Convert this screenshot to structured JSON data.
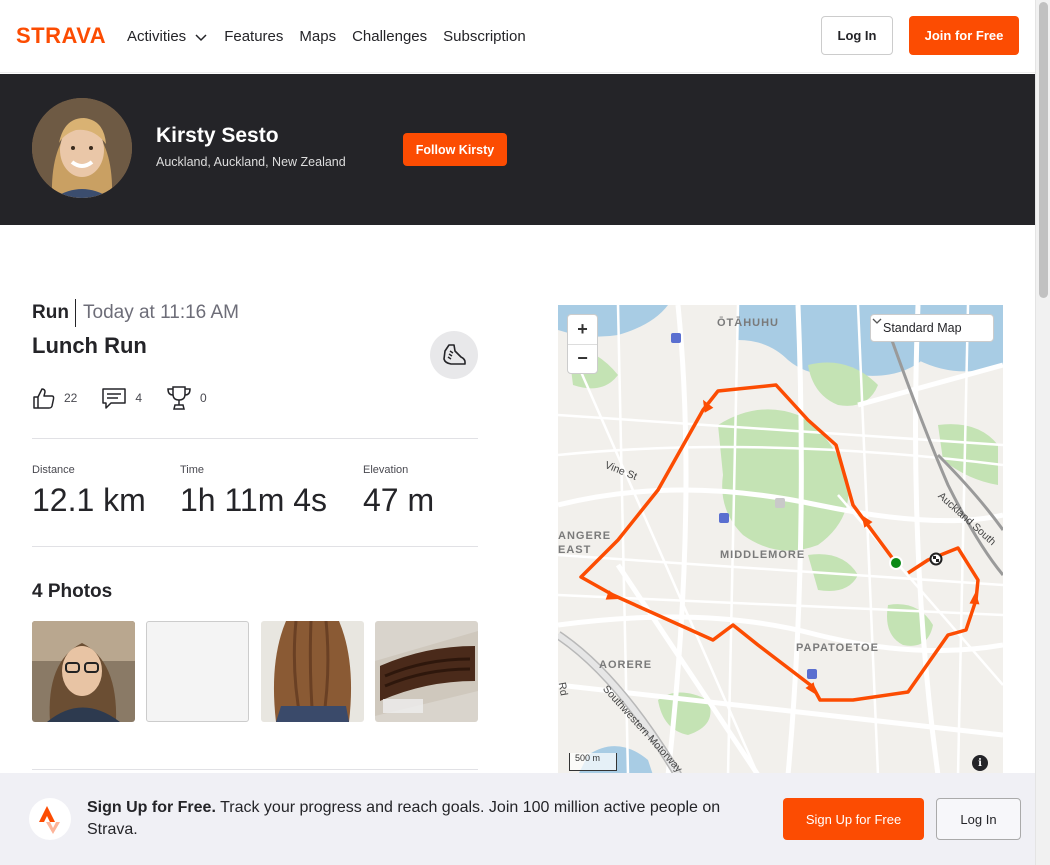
{
  "nav": {
    "logo": "STRAVA",
    "items": [
      {
        "label": "Activities",
        "has_dropdown": true
      },
      {
        "label": "Features"
      },
      {
        "label": "Maps"
      },
      {
        "label": "Challenges"
      },
      {
        "label": "Subscription"
      }
    ],
    "login_label": "Log In",
    "join_label": "Join for Free"
  },
  "athlete": {
    "name": "Kirsty Sesto",
    "location": "Auckland, Auckland, New Zealand",
    "follow_label": "Follow Kirsty"
  },
  "activity": {
    "type": "Run",
    "date": "Today at 11:16 AM",
    "title": "Lunch Run",
    "kudos": "22",
    "comments": "4",
    "achievements": "0"
  },
  "stats": [
    {
      "label": "Distance",
      "value": "12.1 km"
    },
    {
      "label": "Time",
      "value": "1h 11m 4s"
    },
    {
      "label": "Elevation",
      "value": "47 m"
    }
  ],
  "photos": {
    "title": "4 Photos"
  },
  "map": {
    "style_label": "Standard Map",
    "zoom_in": "+",
    "zoom_out": "−",
    "scale_label": "500 m",
    "info_label": "i",
    "labels": {
      "otahuhu": "ŌTĀHUHU",
      "middlemore": "MIDDLEMORE",
      "papatoetoe": "PAPATOETOE",
      "aorere": "AORERE",
      "mangere_east": "ANGERE\nEAST",
      "vine_st": "Vine St",
      "auckland_south": "Auckland South",
      "southwestern": "Southwestern Motorway",
      "rd": "Rd"
    },
    "route_color": "#fc4c02"
  },
  "banner": {
    "headline": "Sign Up for Free.",
    "body": "Track your progress and reach goals. Join 100 million active people on Strava.",
    "signup_label": "Sign Up for Free",
    "login_label": "Log In"
  },
  "colors": {
    "brand": "#fc4c02",
    "dark_band": "#242428"
  }
}
